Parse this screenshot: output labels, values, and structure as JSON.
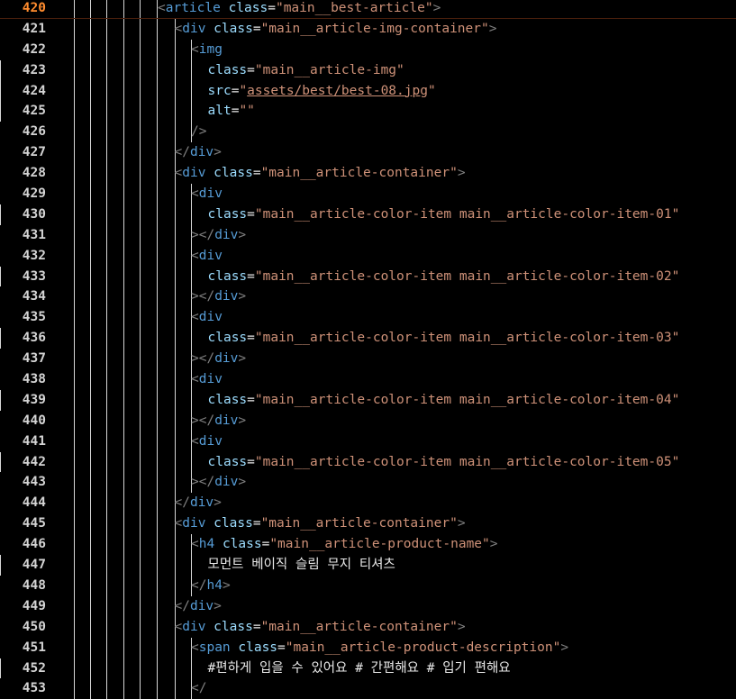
{
  "editor": {
    "current_line": 420,
    "lines": [
      {
        "n": 420,
        "indent": 0,
        "tokens": [
          [
            "p",
            "<"
          ],
          [
            "t",
            "article"
          ],
          [
            "x",
            " "
          ],
          [
            "a",
            "class"
          ],
          [
            "x",
            "="
          ],
          [
            "s",
            "\"main__best-article\""
          ],
          [
            "p",
            ">"
          ]
        ]
      },
      {
        "n": 421,
        "indent": 1,
        "tokens": [
          [
            "p",
            "<"
          ],
          [
            "t",
            "div"
          ],
          [
            "x",
            " "
          ],
          [
            "a",
            "class"
          ],
          [
            "x",
            "="
          ],
          [
            "s",
            "\"main__article-img-container\""
          ],
          [
            "p",
            ">"
          ]
        ]
      },
      {
        "n": 422,
        "indent": 2,
        "tokens": [
          [
            "p",
            "<"
          ],
          [
            "t",
            "img"
          ]
        ]
      },
      {
        "n": 423,
        "indent": 3,
        "tokens": [
          [
            "a",
            "class"
          ],
          [
            "x",
            "="
          ],
          [
            "s",
            "\"main__article-img\""
          ]
        ]
      },
      {
        "n": 424,
        "indent": 3,
        "tokens": [
          [
            "a",
            "src"
          ],
          [
            "x",
            "="
          ],
          [
            "s",
            "\""
          ],
          [
            "u",
            "assets/best/best-08.jpg"
          ],
          [
            "s",
            "\""
          ]
        ]
      },
      {
        "n": 425,
        "indent": 3,
        "tokens": [
          [
            "a",
            "alt"
          ],
          [
            "x",
            "="
          ],
          [
            "s",
            "\"\""
          ]
        ]
      },
      {
        "n": 426,
        "indent": 2,
        "tokens": [
          [
            "p",
            "/>"
          ]
        ]
      },
      {
        "n": 427,
        "indent": 1,
        "tokens": [
          [
            "p",
            "</"
          ],
          [
            "t",
            "div"
          ],
          [
            "p",
            ">"
          ]
        ]
      },
      {
        "n": 428,
        "indent": 1,
        "tokens": [
          [
            "p",
            "<"
          ],
          [
            "t",
            "div"
          ],
          [
            "x",
            " "
          ],
          [
            "a",
            "class"
          ],
          [
            "x",
            "="
          ],
          [
            "s",
            "\"main__article-container\""
          ],
          [
            "p",
            ">"
          ]
        ]
      },
      {
        "n": 429,
        "indent": 2,
        "tokens": [
          [
            "p",
            "<"
          ],
          [
            "t",
            "div"
          ]
        ]
      },
      {
        "n": 430,
        "indent": 3,
        "tokens": [
          [
            "a",
            "class"
          ],
          [
            "x",
            "="
          ],
          [
            "s",
            "\"main__article-color-item main__article-color-item-01\""
          ]
        ]
      },
      {
        "n": 431,
        "indent": 2,
        "tokens": [
          [
            "p",
            "></"
          ],
          [
            "t",
            "div"
          ],
          [
            "p",
            ">"
          ]
        ]
      },
      {
        "n": 432,
        "indent": 2,
        "tokens": [
          [
            "p",
            "<"
          ],
          [
            "t",
            "div"
          ]
        ]
      },
      {
        "n": 433,
        "indent": 3,
        "tokens": [
          [
            "a",
            "class"
          ],
          [
            "x",
            "="
          ],
          [
            "s",
            "\"main__article-color-item main__article-color-item-02\""
          ]
        ]
      },
      {
        "n": 434,
        "indent": 2,
        "tokens": [
          [
            "p",
            "></"
          ],
          [
            "t",
            "div"
          ],
          [
            "p",
            ">"
          ]
        ]
      },
      {
        "n": 435,
        "indent": 2,
        "tokens": [
          [
            "p",
            "<"
          ],
          [
            "t",
            "div"
          ]
        ]
      },
      {
        "n": 436,
        "indent": 3,
        "tokens": [
          [
            "a",
            "class"
          ],
          [
            "x",
            "="
          ],
          [
            "s",
            "\"main__article-color-item main__article-color-item-03\""
          ]
        ]
      },
      {
        "n": 437,
        "indent": 2,
        "tokens": [
          [
            "p",
            "></"
          ],
          [
            "t",
            "div"
          ],
          [
            "p",
            ">"
          ]
        ]
      },
      {
        "n": 438,
        "indent": 2,
        "tokens": [
          [
            "p",
            "<"
          ],
          [
            "t",
            "div"
          ]
        ]
      },
      {
        "n": 439,
        "indent": 3,
        "tokens": [
          [
            "a",
            "class"
          ],
          [
            "x",
            "="
          ],
          [
            "s",
            "\"main__article-color-item main__article-color-item-04\""
          ]
        ]
      },
      {
        "n": 440,
        "indent": 2,
        "tokens": [
          [
            "p",
            "></"
          ],
          [
            "t",
            "div"
          ],
          [
            "p",
            ">"
          ]
        ]
      },
      {
        "n": 441,
        "indent": 2,
        "tokens": [
          [
            "p",
            "<"
          ],
          [
            "t",
            "div"
          ]
        ]
      },
      {
        "n": 442,
        "indent": 3,
        "tokens": [
          [
            "a",
            "class"
          ],
          [
            "x",
            "="
          ],
          [
            "s",
            "\"main__article-color-item main__article-color-item-05\""
          ]
        ]
      },
      {
        "n": 443,
        "indent": 2,
        "tokens": [
          [
            "p",
            "></"
          ],
          [
            "t",
            "div"
          ],
          [
            "p",
            ">"
          ]
        ]
      },
      {
        "n": 444,
        "indent": 1,
        "tokens": [
          [
            "p",
            "</"
          ],
          [
            "t",
            "div"
          ],
          [
            "p",
            ">"
          ]
        ]
      },
      {
        "n": 445,
        "indent": 1,
        "tokens": [
          [
            "p",
            "<"
          ],
          [
            "t",
            "div"
          ],
          [
            "x",
            " "
          ],
          [
            "a",
            "class"
          ],
          [
            "x",
            "="
          ],
          [
            "s",
            "\"main__article-container\""
          ],
          [
            "p",
            ">"
          ]
        ]
      },
      {
        "n": 446,
        "indent": 2,
        "tokens": [
          [
            "p",
            "<"
          ],
          [
            "t",
            "h4"
          ],
          [
            "x",
            " "
          ],
          [
            "a",
            "class"
          ],
          [
            "x",
            "="
          ],
          [
            "s",
            "\"main__article-product-name\""
          ],
          [
            "p",
            ">"
          ]
        ]
      },
      {
        "n": 447,
        "indent": 3,
        "tokens": [
          [
            "x",
            "모먼트 베이직 슬림 무지 티셔츠"
          ]
        ]
      },
      {
        "n": 448,
        "indent": 2,
        "tokens": [
          [
            "p",
            "</"
          ],
          [
            "t",
            "h4"
          ],
          [
            "p",
            ">"
          ]
        ]
      },
      {
        "n": 449,
        "indent": 1,
        "tokens": [
          [
            "p",
            "</"
          ],
          [
            "t",
            "div"
          ],
          [
            "p",
            ">"
          ]
        ]
      },
      {
        "n": 450,
        "indent": 1,
        "tokens": [
          [
            "p",
            "<"
          ],
          [
            "t",
            "div"
          ],
          [
            "x",
            " "
          ],
          [
            "a",
            "class"
          ],
          [
            "x",
            "="
          ],
          [
            "s",
            "\"main__article-container\""
          ],
          [
            "p",
            ">"
          ]
        ]
      },
      {
        "n": 451,
        "indent": 2,
        "tokens": [
          [
            "p",
            "<"
          ],
          [
            "t",
            "span"
          ],
          [
            "x",
            " "
          ],
          [
            "a",
            "class"
          ],
          [
            "x",
            "="
          ],
          [
            "s",
            "\"main__article-product-description\""
          ],
          [
            "p",
            ">"
          ]
        ]
      },
      {
        "n": 452,
        "indent": 3,
        "tokens": [
          [
            "x",
            "#편하게 입을 수 있어요 # 간편해요 # 입기 편해요"
          ]
        ]
      },
      {
        "n": 453,
        "indent": 2,
        "tokens": [
          [
            "p",
            "</"
          ]
        ]
      }
    ]
  },
  "colors": {
    "background": "#000000",
    "line_number": "#d4d4d4",
    "line_number_active": "#ff8c2e",
    "tag": "#569cd6",
    "attribute": "#9cdcfe",
    "string": "#ce9178",
    "punctuation": "#808080",
    "text": "#e8e8e8"
  }
}
